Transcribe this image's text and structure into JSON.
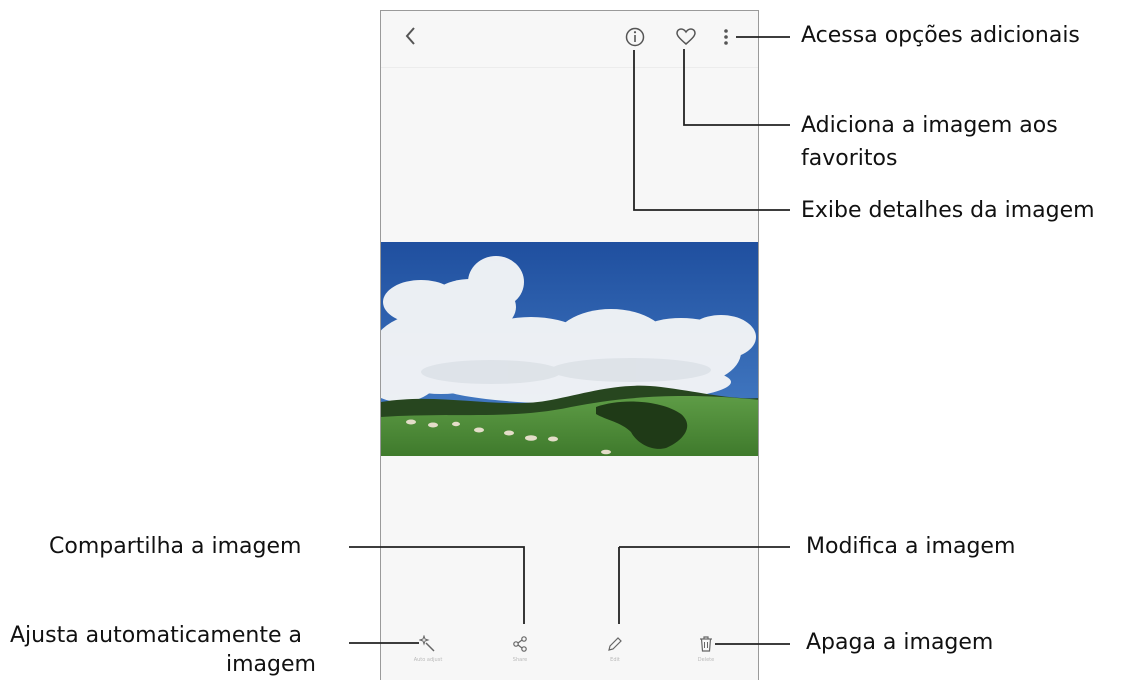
{
  "viewer": {
    "bottom_bar": {
      "auto_adjust_label": "Auto adjust",
      "share_label": "Share",
      "edit_label": "Edit",
      "delete_label": "Delete"
    }
  },
  "callouts": {
    "more_options": "Acessa opções adicionais",
    "favorite_line1": "Adiciona a imagem aos",
    "favorite_line2": "favoritos",
    "details": "Exibe detalhes da imagem",
    "share": "Compartilha a imagem",
    "edit": "Modifica a imagem",
    "auto_adjust_line1": "Ajusta automaticamente a",
    "auto_adjust_line2": "imagem",
    "delete": "Apaga a imagem"
  },
  "icons": {
    "back": "chevron-left-icon",
    "details": "info-icon",
    "favorite": "heart-icon",
    "more": "more-vertical-icon",
    "auto_adjust": "magic-wand-icon",
    "share": "share-icon",
    "edit": "pencil-icon",
    "delete": "trash-icon"
  },
  "colors": {
    "sky": "#2e5fb0",
    "grass": "#4f8d3a",
    "callout_line": "#222222",
    "icon": "#555555"
  }
}
